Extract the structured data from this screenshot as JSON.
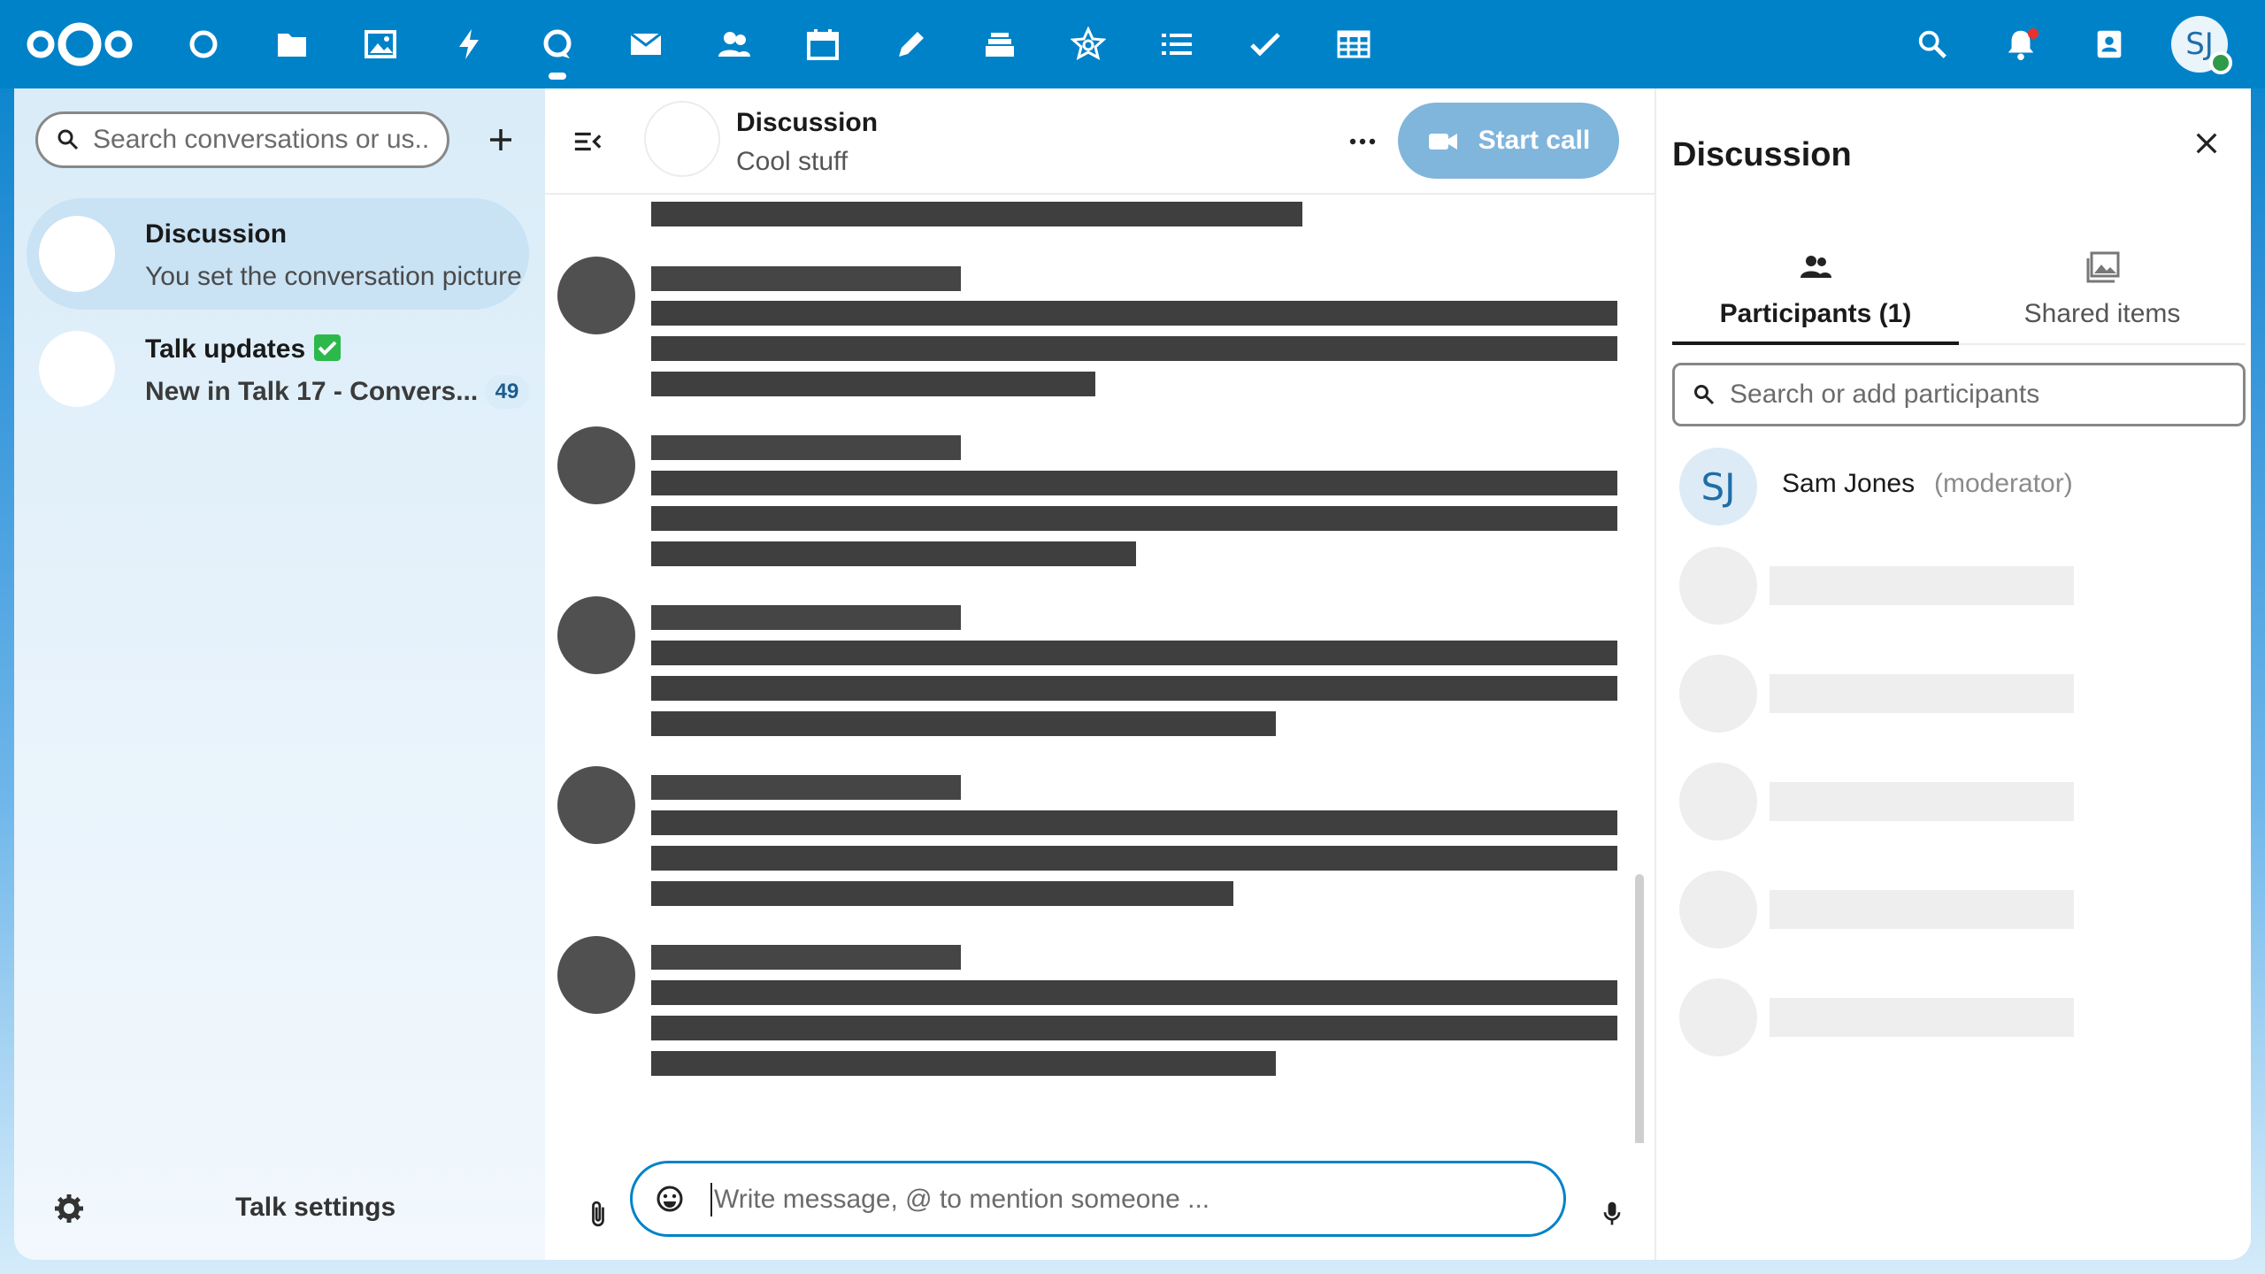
{
  "header": {
    "apps": [
      {
        "name": "dashboard-icon"
      },
      {
        "name": "files-icon"
      },
      {
        "name": "photos-icon"
      },
      {
        "name": "activity-icon"
      },
      {
        "name": "talk-icon"
      },
      {
        "name": "mail-icon"
      },
      {
        "name": "contacts-icon"
      },
      {
        "name": "calendar-icon"
      },
      {
        "name": "notes-icon"
      },
      {
        "name": "deck-icon"
      },
      {
        "name": "circles-icon"
      },
      {
        "name": "list-icon"
      },
      {
        "name": "tasks-icon"
      },
      {
        "name": "tables-icon"
      }
    ],
    "active_app": "talk-icon",
    "user_initials": "SJ",
    "accent_color": "#0082c9"
  },
  "left_nav": {
    "search_placeholder": "Search conversations or us...",
    "conversations": [
      {
        "title": "Discussion",
        "subtitle": "You set the conversation picture",
        "active": true
      },
      {
        "title": "Talk updates",
        "subtitle": "New in Talk 17 - Convers...",
        "unread": "49",
        "verified": true
      }
    ],
    "settings_label": "Talk settings"
  },
  "chat": {
    "title": "Discussion",
    "description": "Cool stuff",
    "start_call_label": "Start call",
    "composer_placeholder": "Write message, @ to mention someone ..."
  },
  "sidebar": {
    "title": "Discussion",
    "tabs": [
      {
        "label": "Participants (1)",
        "active": true
      },
      {
        "label": "Shared items",
        "active": false
      }
    ],
    "participant_search_placeholder": "Search or add participants",
    "participants": [
      {
        "initials": "SJ",
        "name": "Sam Jones",
        "role": "(moderator)"
      }
    ]
  }
}
